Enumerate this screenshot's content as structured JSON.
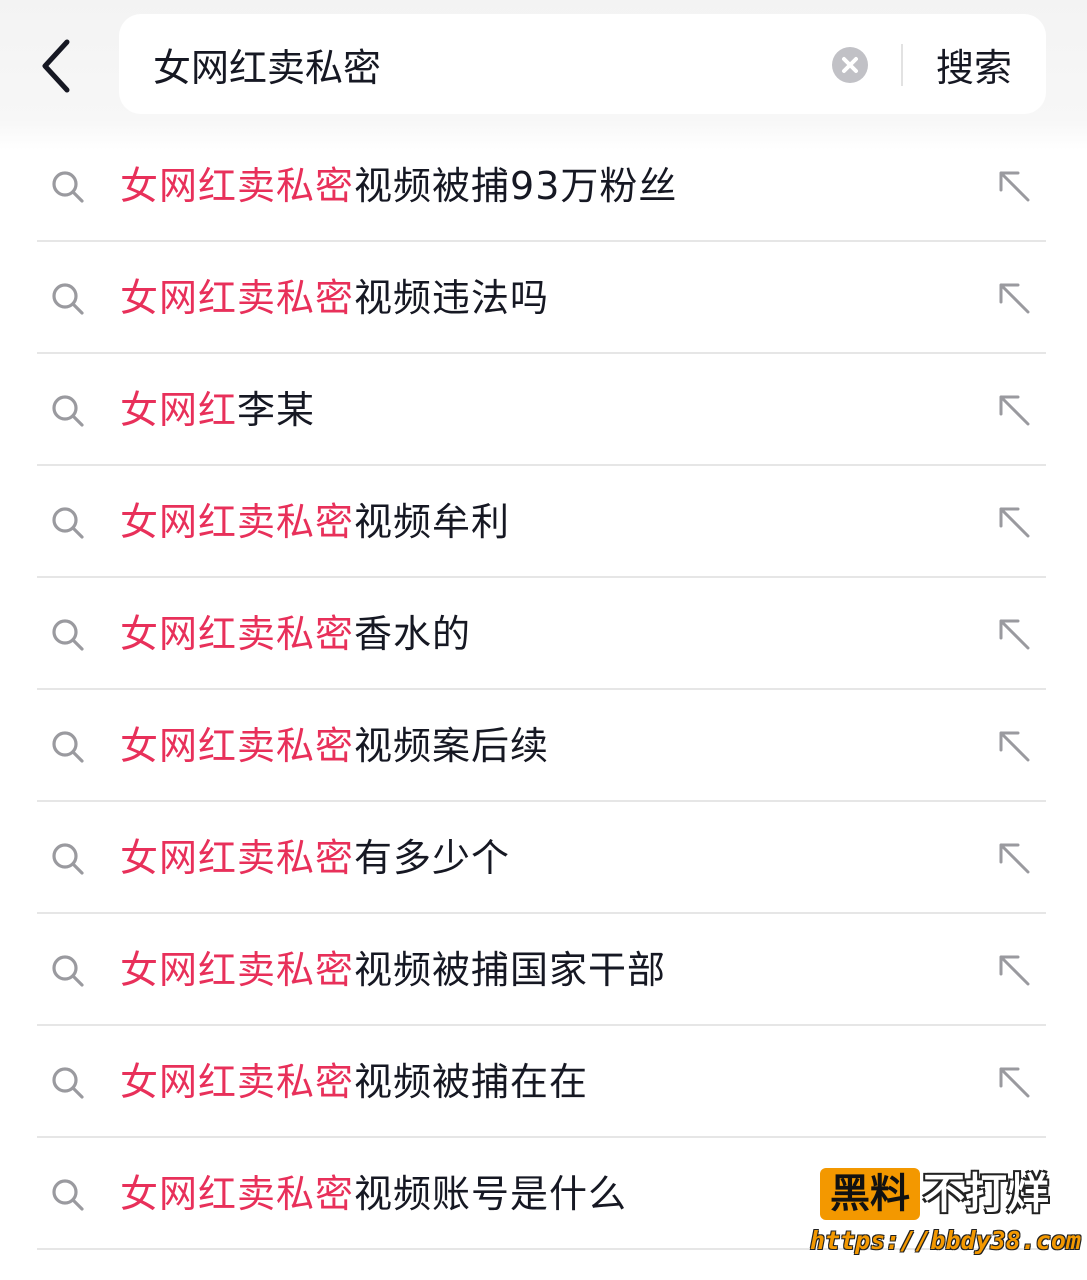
{
  "header": {
    "query": "女网红卖私密",
    "submit_label": "搜索"
  },
  "colors": {
    "highlight": "#e8305a",
    "text": "#161823",
    "icon": "#9a9a9f"
  },
  "suggestions": [
    {
      "match": "女网红卖私密",
      "rest": "视频被捕93万粉丝"
    },
    {
      "match": "女网红卖私密",
      "rest": "视频违法吗"
    },
    {
      "match": "女网红",
      "rest": "李某"
    },
    {
      "match": "女网红卖私密",
      "rest": "视频牟利"
    },
    {
      "match": "女网红卖私密",
      "rest": "香水的"
    },
    {
      "match": "女网红卖私密",
      "rest": "视频案后续"
    },
    {
      "match": "女网红卖私密",
      "rest": "有多少个"
    },
    {
      "match": "女网红卖私密",
      "rest": "视频被捕国家干部"
    },
    {
      "match": "女网红卖私密",
      "rest": "视频被捕在在"
    },
    {
      "match": "女网红卖私密",
      "rest": "视频账号是什么"
    }
  ],
  "watermark": {
    "brand": "黑料",
    "tagline": "不打烊",
    "url": "https://bbdy38.com"
  }
}
